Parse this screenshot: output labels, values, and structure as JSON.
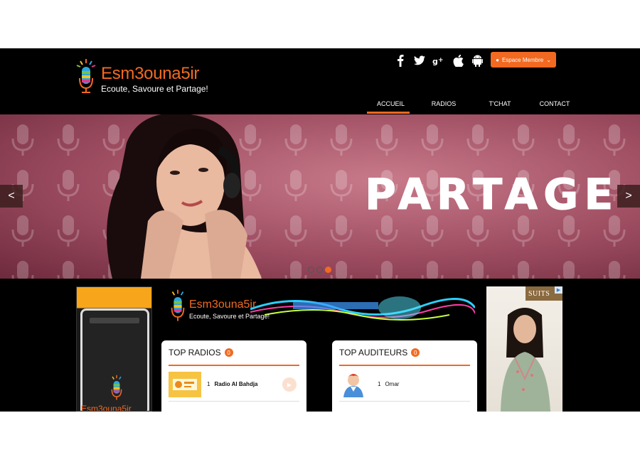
{
  "header": {
    "logo_title": "Esm3ouna5ir",
    "logo_subtitle": "Ecoute, Savoure et Partage!",
    "member_button": "Espace Membre",
    "social_icons": [
      "facebook-icon",
      "twitter-icon",
      "google-plus-icon",
      "apple-icon",
      "android-icon"
    ]
  },
  "nav": {
    "items": [
      {
        "label": "ACCUEIL",
        "active": true
      },
      {
        "label": "RADIOS",
        "active": false
      },
      {
        "label": "T'CHAT",
        "active": false
      },
      {
        "label": "CONTACT",
        "active": false
      }
    ]
  },
  "slider": {
    "text": "PARTAGE",
    "prev_label": "<",
    "next_label": ">",
    "active_dot": 3,
    "dot_count": 3
  },
  "ads": {
    "phone_text": "Esm3ouna5ir",
    "banner_title": "Esm3ouna5ir",
    "banner_subtitle": "Ecoute, Savoure et Partage!",
    "right_brand": "SUITS"
  },
  "top_radios": {
    "title": "TOP RADIOS",
    "badge": "0",
    "rows": [
      {
        "rank": "1",
        "name": "Radio Al Bahdja"
      }
    ]
  },
  "top_listeners": {
    "title": "TOP AUDITEURS",
    "badge": "0",
    "rows": [
      {
        "rank": "1",
        "name": "Omar"
      }
    ]
  },
  "colors": {
    "accent": "#f26a21",
    "background": "#000000"
  }
}
